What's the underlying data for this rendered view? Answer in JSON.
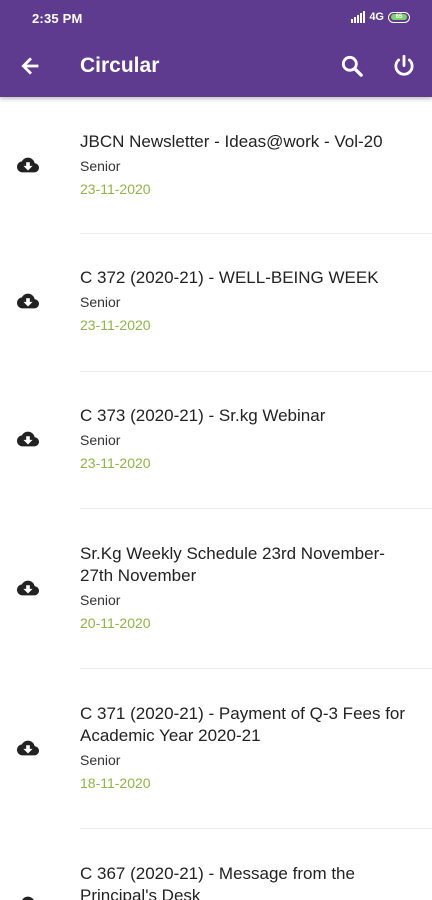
{
  "status_bar": {
    "time": "2:35 PM",
    "network": "4G",
    "battery": "65"
  },
  "toolbar": {
    "title": "Circular",
    "icons": [
      "back-arrow-icon",
      "search-icon",
      "power-icon"
    ]
  },
  "colors": {
    "app_bar": "#5f3b8f",
    "date": "#8fb34a"
  },
  "circulars": [
    {
      "title": "JBCN Newsletter - Ideas@work - Vol-20",
      "category": "Senior",
      "date": "23-11-2020"
    },
    {
      "title": "C 372 (2020-21) - WELL-BEING WEEK",
      "category": "Senior",
      "date": "23-11-2020"
    },
    {
      "title": "C 373 (2020-21) - Sr.kg Webinar",
      "category": "Senior",
      "date": "23-11-2020"
    },
    {
      "title": "Sr.Kg Weekly Schedule 23rd November-27th November",
      "category": "Senior",
      "date": "20-11-2020"
    },
    {
      "title": "C 371 (2020-21) - Payment of Q-3 Fees for Academic Year 2020-21",
      "category": "Senior",
      "date": "18-11-2020"
    },
    {
      "title": "C 367 (2020-21) - Message from the Principal's Desk",
      "category": "",
      "date": ""
    }
  ]
}
